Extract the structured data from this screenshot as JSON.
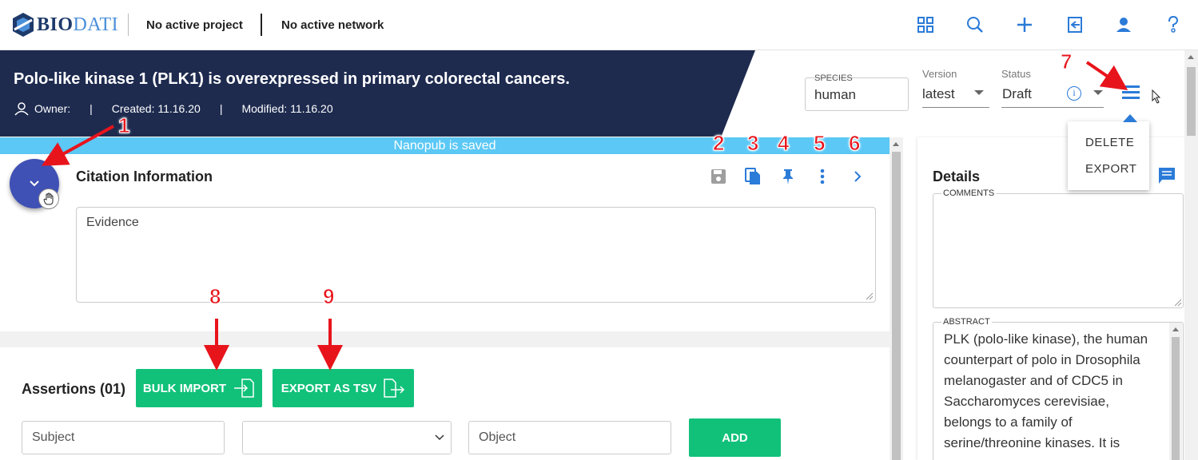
{
  "app": {
    "logo_bio": "BIO",
    "logo_dati": "DATI",
    "project": "No active project",
    "network": "No active network"
  },
  "nav_icons": [
    "apps-grid-icon",
    "search-icon",
    "plus-icon",
    "logout-icon",
    "user-icon",
    "help-icon"
  ],
  "header": {
    "title": "Polo-like kinase 1 (PLK1) is overexpressed in primary colorectal cancers.",
    "owner": "Owner:",
    "sep": "|",
    "created": "Created: 11.16.20",
    "modified": "Modified: 11.16.20",
    "species_label": "SPECIES",
    "species_value": "human",
    "version_label": "Version",
    "version_value": "latest",
    "status_label": "Status",
    "status_value": "Draft"
  },
  "status_bar": "Nanopub is saved",
  "citation": {
    "title": "Citation Information",
    "evidence_placeholder": "Evidence"
  },
  "assertions": {
    "title": "Assertions (01)",
    "bulk_import": "BULK IMPORT",
    "export_tsv": "EXPORT AS TSV",
    "subject_placeholder": "Subject",
    "object_placeholder": "Object",
    "add": "ADD"
  },
  "details": {
    "title": "Details",
    "comments_label": "COMMENTS",
    "abstract_label": "ABSTRACT",
    "abstract_text": "PLK (polo-like kinase), the human counterpart of polo in Drosophila melanogaster and of CDC5 in Saccharomyces cerevisiae, belongs to a family of serine/threonine kinases. It is"
  },
  "menu": {
    "delete": "DELETE",
    "export": "EXPORT"
  },
  "annotations": [
    "1",
    "2",
    "3",
    "4",
    "5",
    "6",
    "7",
    "8",
    "9"
  ],
  "colors": {
    "navy": "#1e2b4f",
    "accent_blue": "#2b7bd8",
    "saved_bar": "#5bc8f5",
    "green": "#11c17a",
    "fab": "#3f51b5",
    "annotation_red": "#e8141c"
  }
}
